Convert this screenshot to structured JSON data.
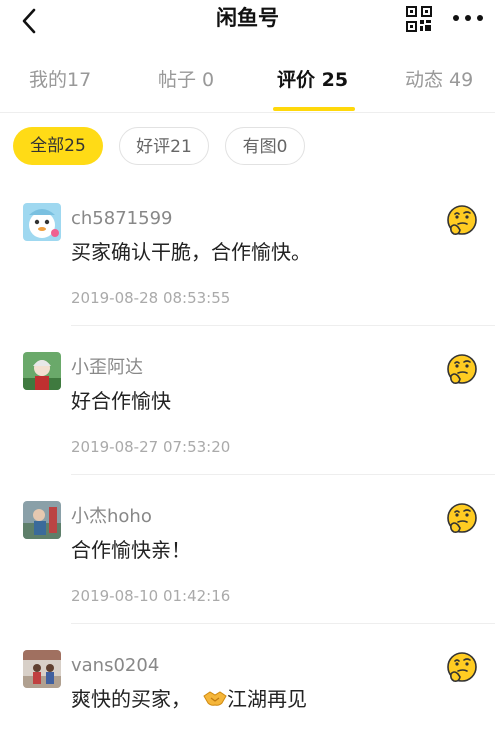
{
  "header": {
    "title": "闲鱼号"
  },
  "tabs": [
    {
      "label": "我的17",
      "active": false
    },
    {
      "label": "帖子 0",
      "active": false
    },
    {
      "label": "评价 25",
      "active": true
    },
    {
      "label": "动态 49",
      "active": false
    }
  ],
  "filters": [
    {
      "label": "全部25",
      "active": true
    },
    {
      "label": "好评21",
      "active": false
    },
    {
      "label": "有图0",
      "active": false
    }
  ],
  "reviews": [
    {
      "name": "ch5871599",
      "text": "买家确认干脆，合作愉快。",
      "time": "2019-08-28 08:53:55",
      "rating_icon": "thinking-face-icon"
    },
    {
      "name": "小歪阿达",
      "text": "好合作愉快",
      "time": "2019-08-27 07:53:20",
      "rating_icon": "thinking-face-icon"
    },
    {
      "name": "小杰hoho",
      "text": "合作愉快亲！",
      "time": "2019-08-10 01:42:16",
      "rating_icon": "thinking-face-icon"
    },
    {
      "name": "vans0204",
      "text_before": "爽快的买家，",
      "text_after": "江湖再见",
      "rating_icon": "thinking-face-icon"
    }
  ],
  "colors": {
    "accent": "#ffd80b",
    "chip_active": "#ffdb16",
    "muted_text": "#999999"
  }
}
